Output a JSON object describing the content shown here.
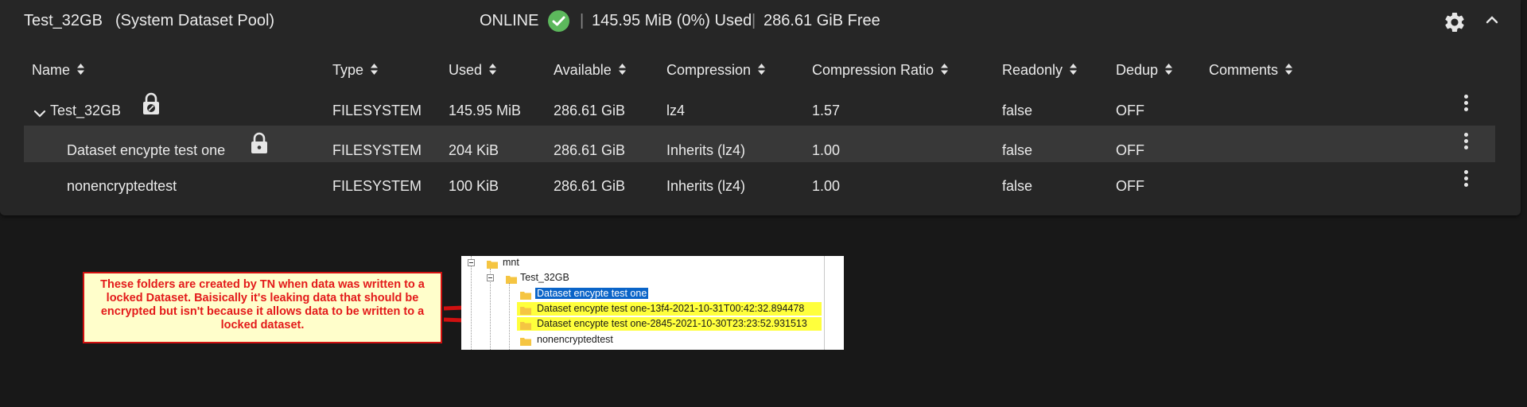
{
  "pool": {
    "name": "Test_32GB",
    "subtitle": "(System Dataset Pool)",
    "status": "ONLINE",
    "used": "145.95 MiB (0%) Used",
    "free": "286.61 GiB Free",
    "separator": "|",
    "status_color": "#5cb85c"
  },
  "table": {
    "columns": [
      "Name",
      "Type",
      "Used",
      "Available",
      "Compression",
      "Compression Ratio",
      "Readonly",
      "Dedup",
      "Comments"
    ],
    "rows": [
      {
        "name": "Test_32GB",
        "type": "FILESYSTEM",
        "used": "145.95 MiB",
        "available": "286.61 GiB",
        "compression": "lz4",
        "ratio": "1.57",
        "readonly": "false",
        "dedup": "OFF",
        "comments": "",
        "lock": "lock-open-icon"
      },
      {
        "name": "Dataset encypte test one",
        "type": "FILESYSTEM",
        "used": "204 KiB",
        "available": "286.61 GiB",
        "compression": "Inherits (lz4)",
        "ratio": "1.00",
        "readonly": "false",
        "dedup": "OFF",
        "comments": "",
        "lock": "lock-closed-icon"
      },
      {
        "name": "nonencryptedtest",
        "type": "FILESYSTEM",
        "used": "100 KiB",
        "available": "286.61 GiB",
        "compression": "Inherits (lz4)",
        "ratio": "1.00",
        "readonly": "false",
        "dedup": "OFF",
        "comments": "",
        "lock": ""
      }
    ]
  },
  "annotation": {
    "text": "These folders are created by TN when data was written to a locked Dataset. Baisically it's leaking data that should be encrypted but isn't because it allows data to be written to a locked dataset.",
    "text_color": "#e31a1a",
    "background": "#fffecb"
  },
  "explorer": {
    "items": [
      {
        "label": "mnt"
      },
      {
        "label": "Test_32GB"
      },
      {
        "label": "Dataset encypte test one",
        "selected": true
      },
      {
        "label": "Dataset encypte test one-13f4-2021-10-31T00:42:32.894478",
        "highlighted": true
      },
      {
        "label": "Dataset encypte test one-2845-2021-10-30T23:23:52.931513",
        "highlighted": true
      },
      {
        "label": "nonencryptedtest"
      }
    ],
    "highlight_color": "#ffff3c",
    "selection_color": "#0a64c8"
  }
}
